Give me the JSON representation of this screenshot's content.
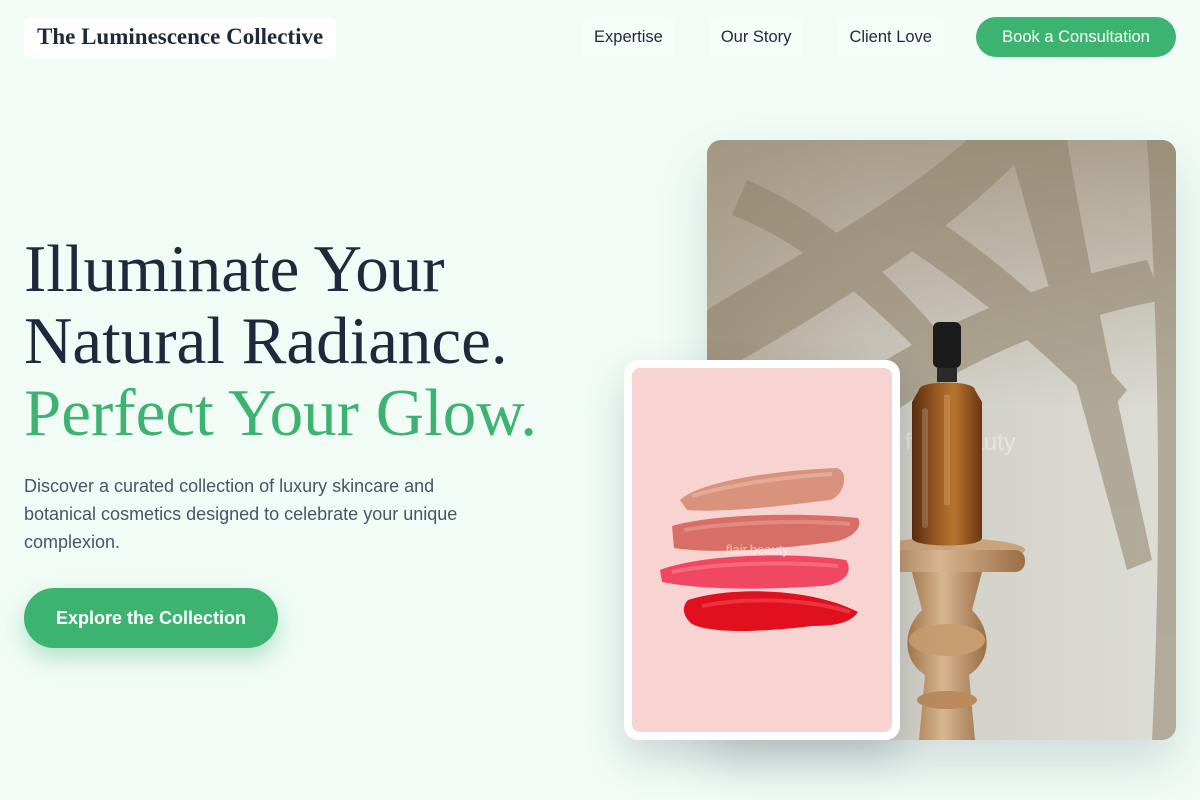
{
  "header": {
    "brand": "The Luminescence Collective",
    "nav": [
      "Expertise",
      "Our Story",
      "Client Love"
    ],
    "cta": "Book a Consultation"
  },
  "hero": {
    "title_line1": "Illuminate Your",
    "title_line2": "Natural Radiance.",
    "title_accent": "Perfect Your Glow.",
    "description": "Discover a curated collection of luxury skincare and botanical cosmetics designed to celebrate your unique complexion.",
    "button": "Explore the Collection"
  },
  "images": {
    "main_watermark": "flairbeauty",
    "card_watermark": "flair.beauty"
  },
  "colors": {
    "background": "#f1fcf6",
    "accent": "#3cb371",
    "heading": "#1e293b",
    "body_text": "#475569"
  }
}
